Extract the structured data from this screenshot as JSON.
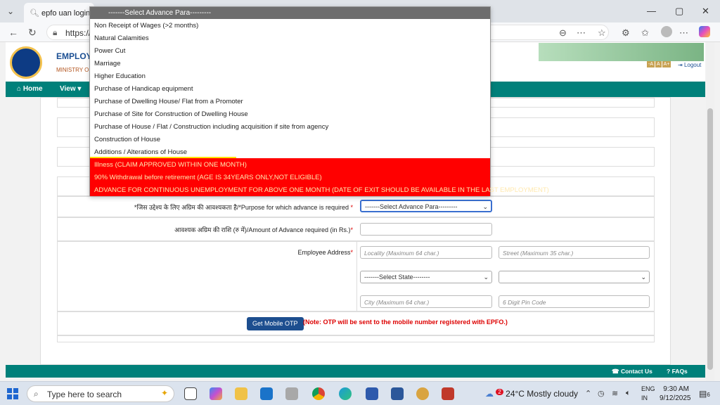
{
  "browser": {
    "tab_title": "epfo uan login -",
    "url": "https://",
    "tab_list_icon": "chevron-down-icon",
    "back_icon": "back-arrow-icon",
    "refresh_icon": "refresh-icon",
    "tools": [
      "zoom-icon",
      "more-icon",
      "favorite-icon",
      "extensions-icon",
      "collections-icon",
      "profile-icon",
      "copilot-icon"
    ]
  },
  "header": {
    "org_name": "EMPLOYEES'",
    "ministry": "MINISTRY OF L",
    "font_sizes": [
      "-A",
      "A",
      "A+"
    ],
    "logout": "Logout"
  },
  "nav": {
    "home": "Home",
    "view": "View"
  },
  "form": {
    "purpose_label": "*जिस उद्देश्य के लिए अग्रिम की आवश्यकता है/*Purpose for which advance is required",
    "purpose_selected": "-------Select Advance Para---------",
    "amount_label": "आवश्यक अग्रिम की राशि (रु में)/Amount of Advance required (in Rs.)",
    "address_label": "Employee Address",
    "locality_placeholder": "Locality (Maximum 64 char.)",
    "street_placeholder": "Street (Maximum 35 char.)",
    "state_selected": "-------Select State--------",
    "district_selected": "",
    "city_placeholder": "City (Maximum 64 char.)",
    "pin_placeholder": "6 Digit Pin Code",
    "otp_button": "Get Mobile OTP",
    "otp_note": "(Note: OTP will be sent to the mobile number registered with EPFO.)"
  },
  "dropdown": {
    "header": "-------Select Advance Para---------",
    "items": [
      {
        "label": "Non Receipt of Wages (>2 months)",
        "style": "normal"
      },
      {
        "label": "Natural Calamities",
        "style": "normal"
      },
      {
        "label": "Power Cut",
        "style": "normal"
      },
      {
        "label": "Marriage",
        "style": "normal"
      },
      {
        "label": "Higher Education",
        "style": "normal"
      },
      {
        "label": "Purchase of Handicap equipment",
        "style": "normal"
      },
      {
        "label": "Purchase of Dwelling House/ Flat from a Promoter",
        "style": "normal"
      },
      {
        "label": "Purchase of Site for Construction of Dwelling House",
        "style": "normal"
      },
      {
        "label": "Purchase of House / Flat / Construction including acquisition if site from agency",
        "style": "normal"
      },
      {
        "label": "Construction of House",
        "style": "normal"
      },
      {
        "label": "Additions / Alterations of House",
        "style": "underlined"
      },
      {
        "label": "Illness (CLAIM APPROVED WITHIN ONE MONTH)",
        "style": "red"
      },
      {
        "label": "90% Withdrawal before retirement (AGE IS 34YEARS ONLY,NOT ELIGIBLE)",
        "style": "red"
      },
      {
        "label": "ADVANCE FOR CONTINUOUS UNEMPLOYMENT FOR ABOVE ONE MONTH (DATE OF EXIT SHOULD BE AVAILABLE IN THE LAST EMPLOYMENT)",
        "style": "red"
      }
    ]
  },
  "footer": {
    "contact": "Contact Us",
    "faqs": "FAQs"
  },
  "taskbar": {
    "search_placeholder": "Type here to search",
    "weather_temp": "24°C",
    "weather_desc": "Mostly cloudy",
    "weather_badge": "2",
    "lang_1": "ENG",
    "lang_2": "IN",
    "time": "9:30 AM",
    "date": "9/12/2025",
    "notif_count": "6"
  },
  "colors": {
    "teal": "#00807a",
    "red_item": "#ff0000",
    "navy_button": "#1d4e8f"
  }
}
